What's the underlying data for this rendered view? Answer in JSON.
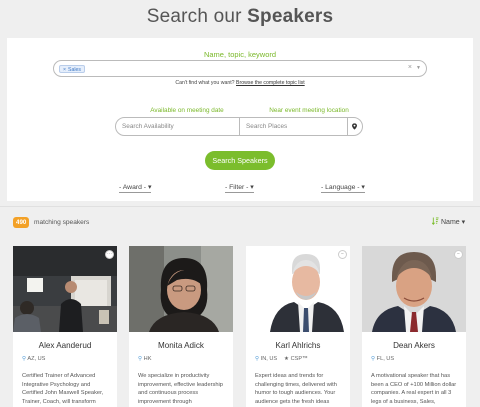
{
  "header": {
    "title_prefix": "Search our",
    "title_strong": "Speakers"
  },
  "search": {
    "label": "Name, topic, keyword",
    "chip": "Sales",
    "help_text": "Can't find what you want?",
    "help_link": "Browse the complete topic list",
    "date_label": "Available on meeting date",
    "location_label": "Near event meeting location",
    "date_placeholder": "Search Availability",
    "location_placeholder": "Search Places",
    "button": "Search Speakers"
  },
  "filters": {
    "award": "- Award -",
    "filter": "- Filter -",
    "language": "- Language -"
  },
  "results": {
    "count": "490",
    "count_label": "matching speakers",
    "sort_label": "Name"
  },
  "speakers": [
    {
      "name": "Alex Aanderud",
      "location": "AZ, US",
      "description": "Certified Trainer of Advanced Integrative Psychology and Certified John Maxwell Speaker, Trainer, Coach, will transform"
    },
    {
      "name": "Monita Adick",
      "location": "HK",
      "description": "We specialize in productivity improvement, effective leadership and continuous process improvement through"
    },
    {
      "name": "Karl Ahlrichs",
      "location": "IN, US",
      "extra": "CSP™",
      "description": "Expert ideas and trends for challenging times, delivered with humor to tough audiences. Your audience gets the fresh ideas"
    },
    {
      "name": "Dean Akers",
      "location": "FL, US",
      "description": "A motivational speaker that has been a CEO of +100 Million dollar companies. A real expert in all 3 legs of a business, Sales,"
    }
  ],
  "colors": {
    "accent_green": "#7bbd2c",
    "badge_orange": "#f3a127",
    "link_blue": "#3d78c5"
  }
}
